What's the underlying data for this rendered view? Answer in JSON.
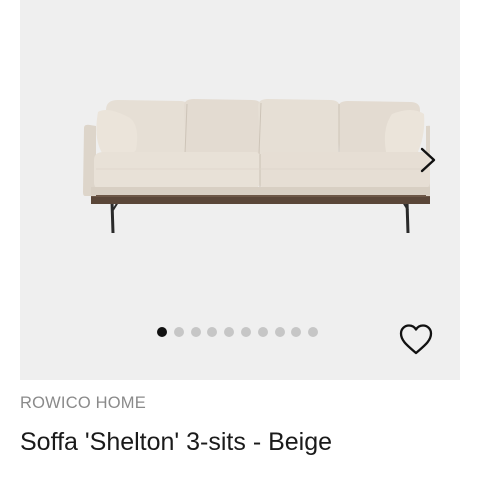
{
  "gallery": {
    "image_subject": "beige three-seat sofa",
    "image_count": 10,
    "active_index": 0,
    "icons": {
      "next": "chevron-right-icon",
      "favorite": "heart-outline-icon"
    }
  },
  "product": {
    "brand": "ROWICO HOME",
    "title": "Soffa 'Shelton' 3-sits - Beige"
  },
  "colors": {
    "gallery_bg": "#efefef",
    "sofa_fabric": "#e4dcd2",
    "active_dot": "#111111",
    "inactive_dot": "#c6c6c6",
    "brand_text": "#8a8a8a",
    "title_text": "#1a1a1a"
  }
}
